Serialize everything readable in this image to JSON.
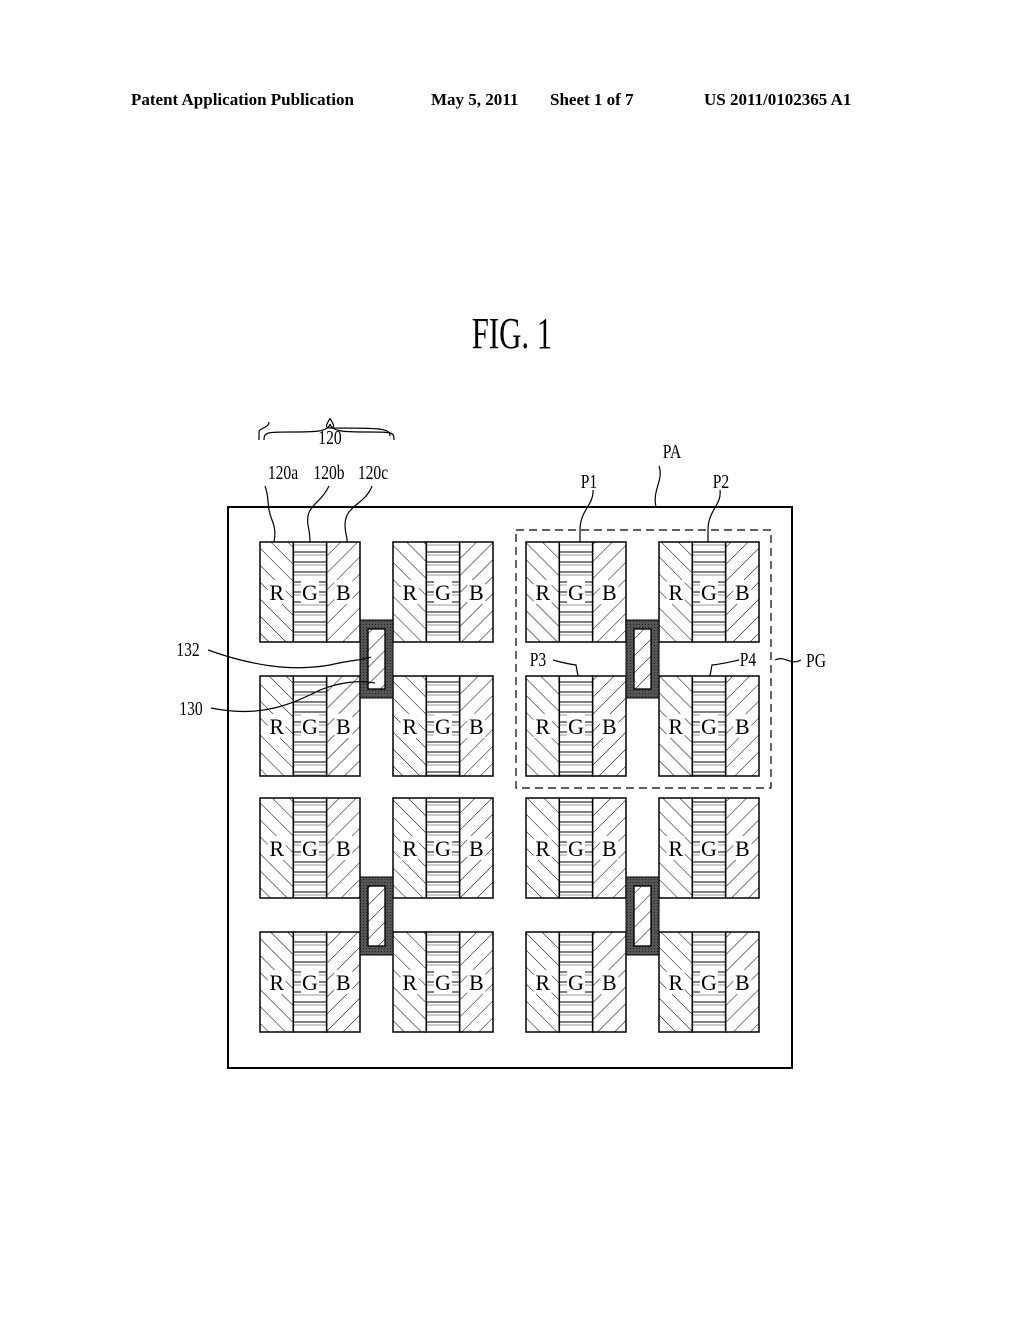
{
  "header": {
    "publication": "Patent Application Publication",
    "date": "May 5, 2011",
    "sheet": "Sheet 1 of 7",
    "number": "US 2011/0102365 A1"
  },
  "figure": {
    "title": "FIG. 1",
    "subpixel_letters": [
      "R",
      "G",
      "B"
    ],
    "labels": {
      "group_120": "120",
      "sub_120a": "120a",
      "sub_120b": "120b",
      "sub_120c": "120c",
      "panel": "PA",
      "pixel_p1": "P1",
      "pixel_p2": "P2",
      "pixel_p3": "P3",
      "pixel_p4": "P4",
      "pixel_group": "PG",
      "ref_132": "132",
      "ref_130": "130"
    }
  }
}
